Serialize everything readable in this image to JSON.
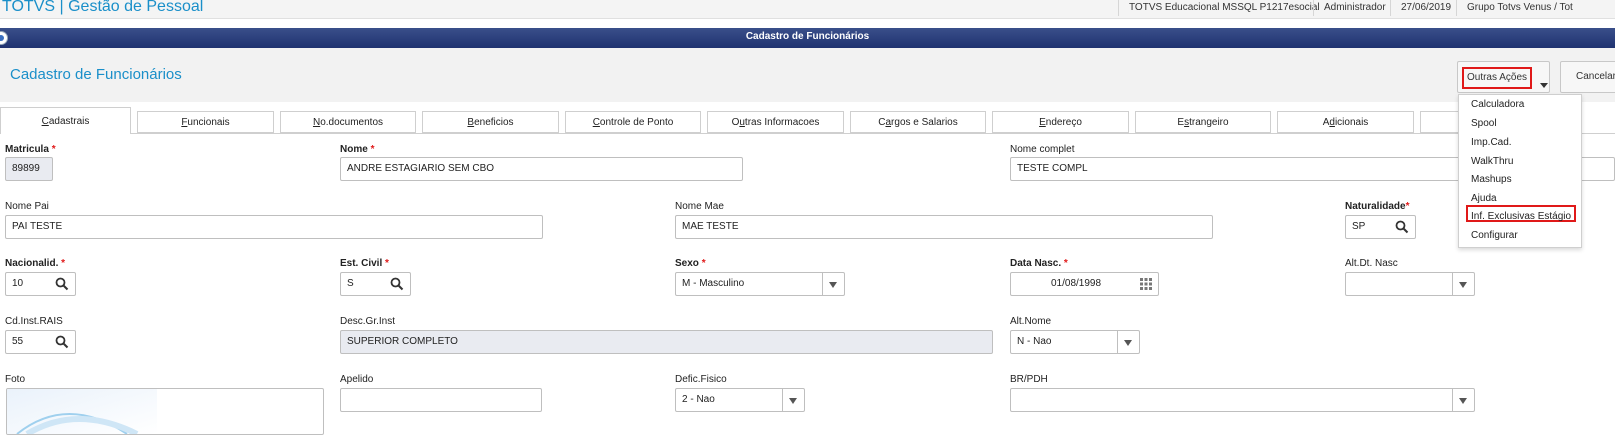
{
  "app": {
    "title": "TOTVS | Gestão de Pessoal"
  },
  "status_bar": [
    "TOTVS Educacional MSSQL P1217esocial",
    "Administrador",
    "27/06/2019",
    "Grupo Totvs Venus / Tot"
  ],
  "window": {
    "title": "Cadastro de Funcionários"
  },
  "header": {
    "title": "Cadastro de Funcionários",
    "outras_acoes": "Outras Ações",
    "cancelar": "Cancelar"
  },
  "tabs": [
    "Cadastrais",
    "Funcionais",
    "No.documentos",
    "Beneficios",
    "Controle de Ponto",
    "Outras Informacoes",
    "Cargos e Salarios",
    "Endereço",
    "Estrangeiro",
    "Adicionais"
  ],
  "tab_mnemonic": [
    {
      "pre": "",
      "u": "C",
      "post": "adastrais"
    },
    {
      "pre": "",
      "u": "F",
      "post": "uncionais"
    },
    {
      "pre": "",
      "u": "N",
      "post": "o.documentos"
    },
    {
      "pre": "",
      "u": "B",
      "post": "eneficios"
    },
    {
      "pre": "",
      "u": "C",
      "post": "ontrole de Ponto"
    },
    {
      "pre": "O",
      "u": "u",
      "post": "tras Informacoes"
    },
    {
      "pre": "C",
      "u": "a",
      "post": "rgos e Salarios"
    },
    {
      "pre": "",
      "u": "E",
      "post": "ndereço"
    },
    {
      "pre": "E",
      "u": "s",
      "post": "trangeiro"
    },
    {
      "pre": "A",
      "u": "d",
      "post": "icionais"
    }
  ],
  "menu": [
    "Calculadora",
    "Spool",
    "Imp.Cad.",
    "WalkThru",
    "Mashups",
    "Ajuda",
    "Inf. Exclusivas Estágio",
    "Configurar"
  ],
  "form": {
    "matricula": {
      "label": "Matricula",
      "value": "89899"
    },
    "nome": {
      "label": "Nome",
      "value": "ANDRE ESTAGIARIO SEM CBO"
    },
    "nome_complet": {
      "label": "Nome complet",
      "value": "TESTE COMPL"
    },
    "nome_pai": {
      "label": "Nome Pai",
      "value": "PAI TESTE"
    },
    "nome_mae": {
      "label": "Nome Mae",
      "value": "MAE TESTE"
    },
    "naturalidade": {
      "label": "Naturalidade",
      "value": "SP"
    },
    "nacionalid": {
      "label": "Nacionalid.",
      "value": "10"
    },
    "est_civil": {
      "label": "Est. Civil",
      "value": "S"
    },
    "sexo": {
      "label": "Sexo",
      "value": "M - Masculino"
    },
    "data_nasc": {
      "label": "Data Nasc.",
      "value": "01/08/1998"
    },
    "alt_dt_nasc": {
      "label": "Alt.Dt. Nasc",
      "value": ""
    },
    "cd_inst_rais": {
      "label": "Cd.Inst.RAIS",
      "value": "55"
    },
    "desc_gr_inst": {
      "label": "Desc.Gr.Inst",
      "value": "SUPERIOR COMPLETO"
    },
    "alt_nome": {
      "label": "Alt.Nome",
      "value": "N - Nao"
    },
    "foto": {
      "label": "Foto"
    },
    "apelido": {
      "label": "Apelido",
      "value": ""
    },
    "defic_fisico": {
      "label": "Defic.Fisico",
      "value": "2 - Nao"
    },
    "br_pdh": {
      "label": "BR/PDH",
      "value": ""
    },
    "required_mark": "*"
  },
  "colors": {
    "brand": "#1a8fc9",
    "window_bar": "#2a3d7a",
    "required": "#e01919",
    "highlight": "#e01919"
  }
}
